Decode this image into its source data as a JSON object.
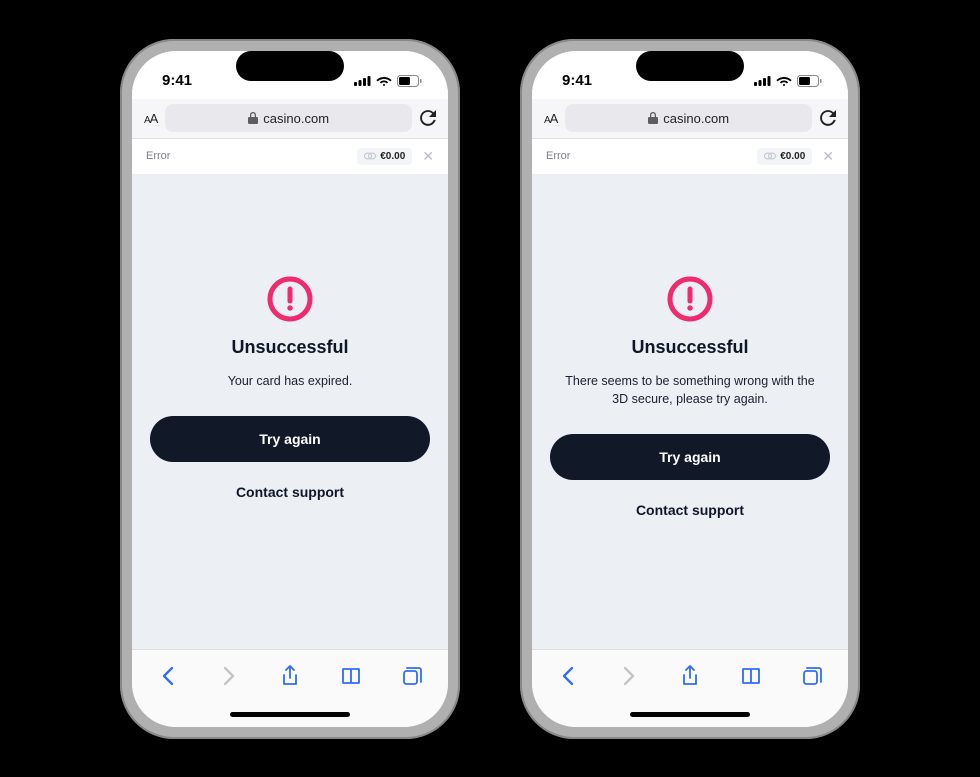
{
  "status": {
    "time": "9:41"
  },
  "browser": {
    "text_size_label": "AA",
    "url": "casino.com"
  },
  "header": {
    "title": "Error",
    "balance": "€0.00"
  },
  "screens": [
    {
      "title": "Unsuccessful",
      "message": "Your card has expired.",
      "primary_button": "Try again",
      "secondary_button": "Contact support"
    },
    {
      "title": "Unsuccessful",
      "message": "There seems to be something wrong with the 3D secure, please try again.",
      "primary_button": "Try again",
      "secondary_button": "Contact support"
    }
  ],
  "colors": {
    "accent_error": "#ef2b6d",
    "button_dark": "#111827",
    "content_bg": "#eceff4"
  }
}
